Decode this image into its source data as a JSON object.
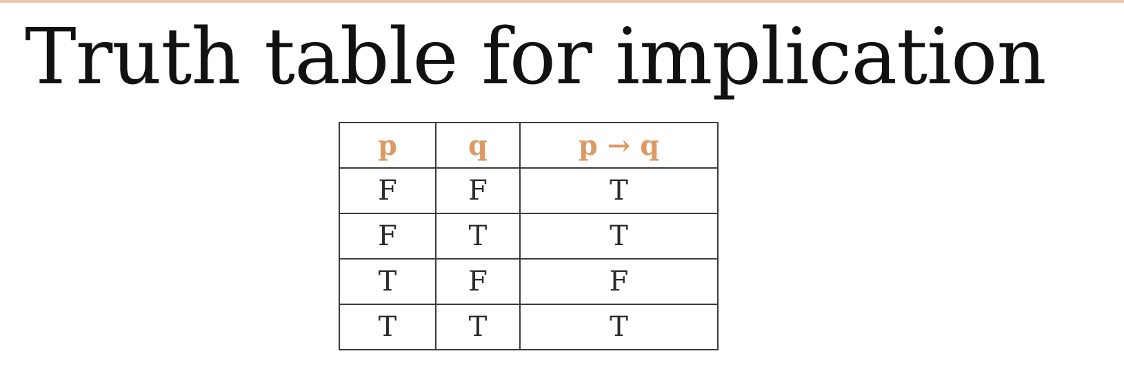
{
  "slide": {
    "title": "Truth table for implication",
    "accent_color": "#dc9a62"
  },
  "table": {
    "headers": [
      "p",
      "q",
      "p → q"
    ],
    "rows": [
      [
        "F",
        "F",
        "T"
      ],
      [
        "F",
        "T",
        "T"
      ],
      [
        "T",
        "F",
        "F"
      ],
      [
        "T",
        "T",
        "T"
      ]
    ]
  }
}
